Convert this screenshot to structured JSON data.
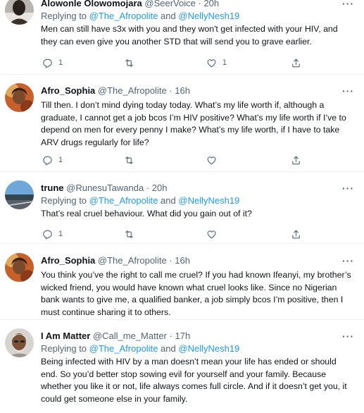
{
  "tweets": [
    {
      "name": "Alowonle Olowomojara",
      "handle": "@SeerVoice",
      "time": "20h",
      "replying_prefix": "Replying to",
      "replying_to_1": "@The_Afropolite",
      "replying_and": "and",
      "replying_to_2": "@NellyNesh19",
      "text": "Men can still have s3x with you and they won't get infected with your HIV, and they can even give you another STD that will send you to grave earlier.",
      "replies": "1",
      "retweets": "",
      "likes": "1"
    },
    {
      "name": "Afro_Sophia",
      "handle": "@The_Afropolite",
      "time": "16h",
      "text": "Till then. I don’t mind dying today today. What’s my life worth if, although a graduate, I cannot get a job bcos I’m HIV positive? What’s my life worth if I’ve to depend on men for every penny I make? What’s my life worth, if I have to take ARV drugs regularly for life?",
      "replies": "1",
      "retweets": "",
      "likes": ""
    },
    {
      "name": "trune",
      "handle": "@RunesuTawanda",
      "time": "20h",
      "replying_prefix": "Replying to",
      "replying_to_1": "@The_Afropolite",
      "replying_and": "and",
      "replying_to_2": "@NellyNesh19",
      "text": "That’s real cruel behaviour. What did you gain out of it?",
      "replies": "1",
      "retweets": "",
      "likes": ""
    },
    {
      "name": "Afro_Sophia",
      "handle": "@The_Afropolite",
      "time": "16h",
      "text": "You think you’ve the right to call me cruel? If you had known Ifeanyi, my brother’s wicked friend, you would have known what cruel looks like. Since no Nigerian bank wants to give me, a qualified banker, a job simply bcos I’m positive, then I must continue sharing it to others.",
      "replies": "",
      "retweets": "",
      "likes": ""
    },
    {
      "name": "I Am Matter",
      "handle": "@Call_me_Matter",
      "time": "17h",
      "replying_prefix": "Replying to",
      "replying_to_1": "@The_Afropolite",
      "replying_and": "and",
      "replying_to_2": "@NellyNesh19",
      "text": "Being infected with HIV by a man doesn’t mean your life has ended or should end. So you’d better stop sowing evil for yourself and your family. Because whether you like it or not, life always comes full circle. And if it doesn’t get you, it could get someone else in your family.",
      "replies": "",
      "retweets": "",
      "likes": ""
    }
  ],
  "separator": "·",
  "icons": {
    "reply": "reply-icon",
    "retweet": "retweet-icon",
    "like": "heart-icon",
    "share": "share-icon",
    "more": "more-icon"
  },
  "colors": {
    "link": "#1d9bf0",
    "muted": "#536471",
    "text": "#0f1419"
  }
}
